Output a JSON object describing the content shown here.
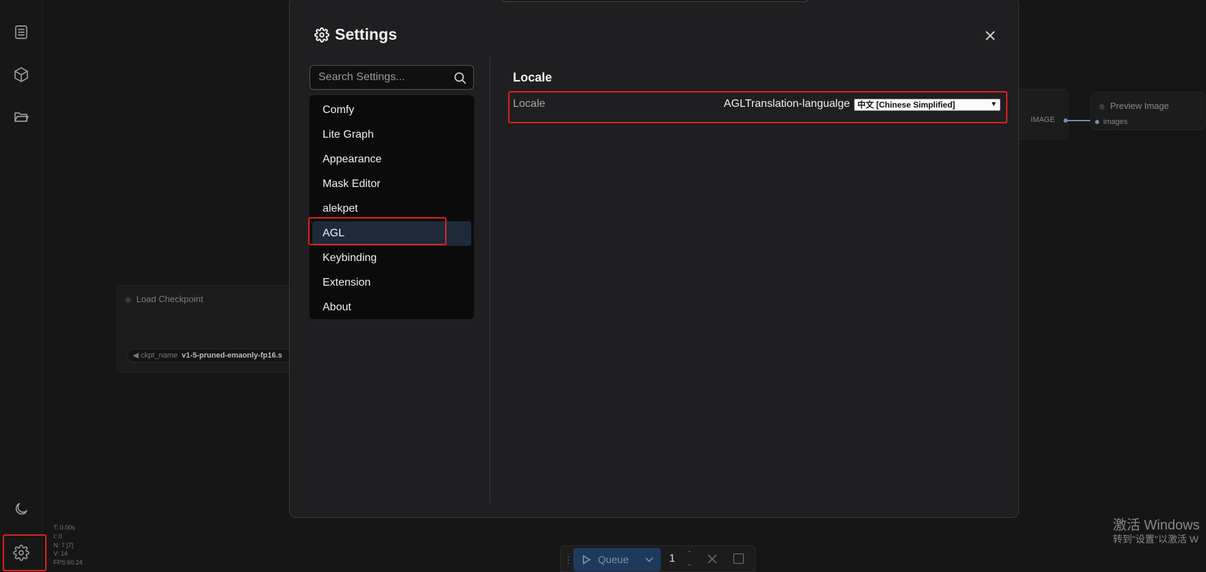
{
  "sidebar": {
    "icons": [
      "queue-list-icon",
      "model-library-icon",
      "workflows-folder-icon",
      "theme-moon-icon",
      "settings-gear-icon"
    ]
  },
  "stats": {
    "t": "T: 0.00s",
    "i": "I: 0",
    "n": "N: 7 [7]",
    "v": "V: 14",
    "fps": "FPS:60.24"
  },
  "graph": {
    "load_checkpoint": {
      "title": "Load Checkpoint",
      "widget_name": "ckpt_name",
      "widget_value": "v1-5-pruned-emaonly-fp16.s"
    },
    "preview_image": {
      "title": "Preview Image",
      "input_label": "images"
    },
    "image_output_label": "IMAGE"
  },
  "dialog": {
    "title": "Settings",
    "search_placeholder": "Search Settings...",
    "categories": [
      "Comfy",
      "Lite Graph",
      "Appearance",
      "Mask Editor",
      "alekpet",
      "AGL",
      "Keybinding",
      "Extension",
      "About"
    ],
    "active_category": "AGL",
    "section_title": "Locale",
    "setting": {
      "label": "Locale",
      "name": "AGLTranslation-langualge",
      "value": "中文 [Chinese Simplified]"
    }
  },
  "queue": {
    "label": "Queue",
    "count": "1"
  },
  "watermark": {
    "line1": "激活 Windows",
    "line2": "转到\"设置\"以激活 W"
  },
  "colors": {
    "highlight": "#e2211c",
    "queue_button": "#1d3a5c",
    "active_category": "#1e2a3a"
  }
}
